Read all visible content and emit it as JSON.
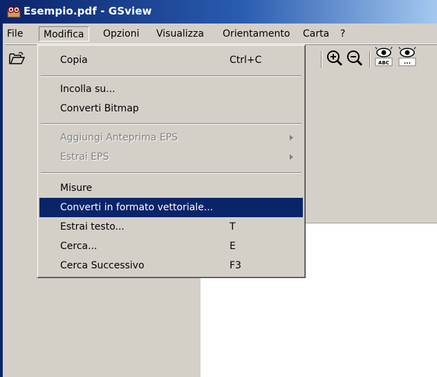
{
  "window": {
    "title": "Esempio.pdf - GSview"
  },
  "menubar": {
    "items": [
      "File",
      "Modifica",
      "Opzioni",
      "Visualizza",
      "Orientamento",
      "Carta",
      "?"
    ],
    "active": "Modifica"
  },
  "dropdown": {
    "items": [
      {
        "label": "Copia",
        "shortcut": "Ctrl+C",
        "enabled": true
      },
      {
        "label": "Incolla su...",
        "shortcut": "",
        "enabled": true
      },
      {
        "label": "Converti Bitmap",
        "shortcut": "",
        "enabled": true
      },
      {
        "label": "Aggiungi Anteprima EPS",
        "shortcut": "",
        "enabled": false,
        "submenu": true
      },
      {
        "label": "Estrai EPS",
        "shortcut": "",
        "enabled": false,
        "submenu": true
      },
      {
        "label": "Misure",
        "shortcut": "",
        "enabled": true
      },
      {
        "label": "Converti in formato vettoriale...",
        "shortcut": "",
        "enabled": true,
        "highlighted": true
      },
      {
        "label": "Estrai testo...",
        "shortcut": "T",
        "enabled": true
      },
      {
        "label": "Cerca...",
        "shortcut": "E",
        "enabled": true
      },
      {
        "label": "Cerca Successivo",
        "shortcut": "F3",
        "enabled": true
      }
    ]
  },
  "toolbar": {
    "icons": [
      "open-folder-icon",
      "zoom-in-icon",
      "zoom-out-icon",
      "view-text-icon",
      "view-more-icon"
    ],
    "zoom_in_glyph": "+",
    "zoom_out_glyph": "−",
    "eye_abc_label": "ABC",
    "eye_dots_label": "..."
  },
  "colors": {
    "title_start": "#0a246a",
    "title_end": "#a6caf0",
    "menu_bg": "#d4d0c8",
    "highlight": "#0a246a"
  }
}
